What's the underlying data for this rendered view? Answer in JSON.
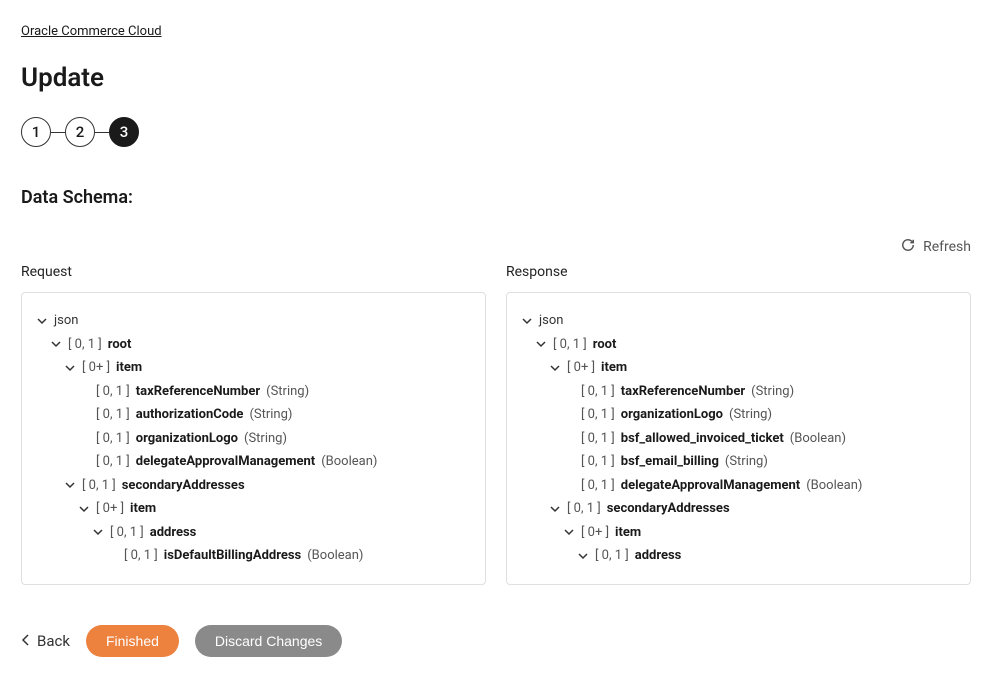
{
  "breadcrumb": "Oracle Commerce Cloud",
  "page_title": "Update",
  "steps": {
    "s1": "1",
    "s2": "2",
    "s3": "3"
  },
  "section_title": "Data Schema:",
  "refresh_label": "Refresh",
  "columns": {
    "request": {
      "header": "Request",
      "json_label": "json",
      "rows": [
        {
          "cardinality": "[ 0, 1 ]",
          "name": "root",
          "type": ""
        },
        {
          "cardinality": "[ 0+ ]",
          "name": "item",
          "type": ""
        },
        {
          "cardinality": "[ 0, 1 ]",
          "name": "taxReferenceNumber",
          "type": "(String)"
        },
        {
          "cardinality": "[ 0, 1 ]",
          "name": "authorizationCode",
          "type": "(String)"
        },
        {
          "cardinality": "[ 0, 1 ]",
          "name": "organizationLogo",
          "type": "(String)"
        },
        {
          "cardinality": "[ 0, 1 ]",
          "name": "delegateApprovalManagement",
          "type": "(Boolean)"
        },
        {
          "cardinality": "[ 0, 1 ]",
          "name": "secondaryAddresses",
          "type": ""
        },
        {
          "cardinality": "[ 0+ ]",
          "name": "item",
          "type": ""
        },
        {
          "cardinality": "[ 0, 1 ]",
          "name": "address",
          "type": ""
        },
        {
          "cardinality": "[ 0, 1 ]",
          "name": "isDefaultBillingAddress",
          "type": "(Boolean)"
        }
      ]
    },
    "response": {
      "header": "Response",
      "json_label": "json",
      "rows": [
        {
          "cardinality": "[ 0, 1 ]",
          "name": "root",
          "type": ""
        },
        {
          "cardinality": "[ 0+ ]",
          "name": "item",
          "type": ""
        },
        {
          "cardinality": "[ 0, 1 ]",
          "name": "taxReferenceNumber",
          "type": "(String)"
        },
        {
          "cardinality": "[ 0, 1 ]",
          "name": "organizationLogo",
          "type": "(String)"
        },
        {
          "cardinality": "[ 0, 1 ]",
          "name": "bsf_allowed_invoiced_ticket",
          "type": "(Boolean)"
        },
        {
          "cardinality": "[ 0, 1 ]",
          "name": "bsf_email_billing",
          "type": "(String)"
        },
        {
          "cardinality": "[ 0, 1 ]",
          "name": "delegateApprovalManagement",
          "type": "(Boolean)"
        },
        {
          "cardinality": "[ 0, 1 ]",
          "name": "secondaryAddresses",
          "type": ""
        },
        {
          "cardinality": "[ 0+ ]",
          "name": "item",
          "type": ""
        },
        {
          "cardinality": "[ 0, 1 ]",
          "name": "address",
          "type": ""
        }
      ]
    }
  },
  "back_label": "Back",
  "finished_label": "Finished",
  "discard_label": "Discard Changes"
}
